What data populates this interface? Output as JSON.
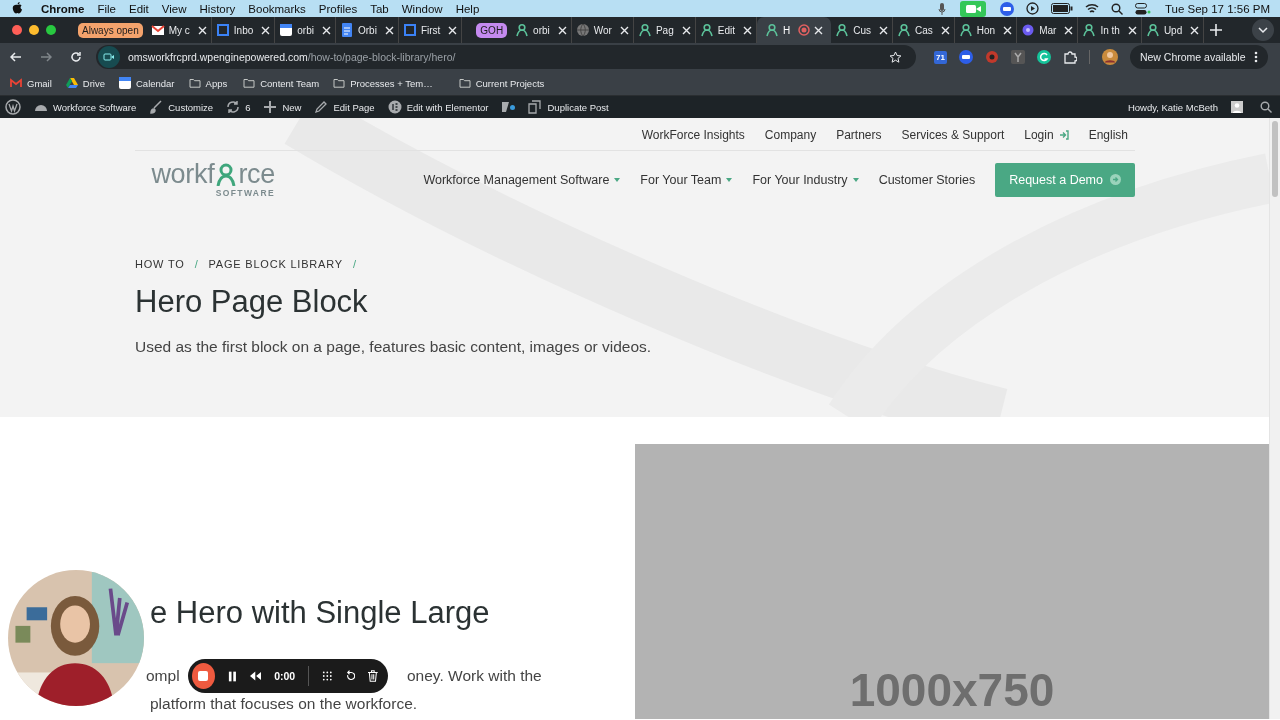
{
  "menu_bar": {
    "app": "Chrome",
    "items": [
      "File",
      "Edit",
      "View",
      "History",
      "Bookmarks",
      "Profiles",
      "Tab",
      "Window",
      "Help"
    ],
    "clock": "Tue Sep 17  1:56 PM"
  },
  "tabs": [
    {
      "label": "Always open",
      "kind": "group",
      "color": "#f4a36c"
    },
    {
      "label": "My c",
      "kind": "tab",
      "selected": false
    },
    {
      "label": "Inbo",
      "kind": "tab",
      "selected": false
    },
    {
      "label": "orbi",
      "kind": "tab",
      "selected": false
    },
    {
      "label": "Orbi",
      "kind": "tab",
      "selected": false
    },
    {
      "label": "First",
      "kind": "tab",
      "selected": false
    },
    {
      "label": "GOH",
      "kind": "group",
      "color": "#c58af0"
    },
    {
      "label": "orbi",
      "kind": "tab",
      "selected": false
    },
    {
      "label": "Wor",
      "kind": "tab",
      "selected": false
    },
    {
      "label": "Pag",
      "kind": "tab",
      "selected": false
    },
    {
      "label": "Edit",
      "kind": "tab",
      "selected": false
    },
    {
      "label": "H",
      "kind": "tab",
      "selected": true
    },
    {
      "label": "Cus",
      "kind": "tab",
      "selected": false
    },
    {
      "label": "Cas",
      "kind": "tab",
      "selected": false
    },
    {
      "label": "Hon",
      "kind": "tab",
      "selected": false
    },
    {
      "label": "Mar",
      "kind": "tab",
      "selected": false
    },
    {
      "label": "In th",
      "kind": "tab",
      "selected": false
    },
    {
      "label": "Upd",
      "kind": "tab",
      "selected": false
    }
  ],
  "address": {
    "host": "omsworkfrcprd.wpenginepowered.com",
    "path": "/how-to/page-block-library/hero/"
  },
  "extension_badge": "71",
  "update_button": "New Chrome available",
  "bookmarks": [
    {
      "label": "Gmail",
      "kind": "gmail"
    },
    {
      "label": "Drive",
      "kind": "drive"
    },
    {
      "label": "Calendar",
      "kind": "calendar"
    },
    {
      "label": "Apps",
      "kind": "folder"
    },
    {
      "label": "Content Team",
      "kind": "folder"
    },
    {
      "label": "Processes + Tem…",
      "kind": "folder"
    },
    {
      "label": "Current Projects",
      "kind": "folder"
    }
  ],
  "admin_bar": {
    "items": [
      {
        "label": "Workforce Software",
        "kind": "site"
      },
      {
        "label": "Customize",
        "kind": "brush"
      },
      {
        "label": "6",
        "kind": "updates"
      },
      {
        "label": "New",
        "kind": "plus"
      },
      {
        "label": "Edit Page",
        "kind": "pencil"
      },
      {
        "label": "Edit with Elementor",
        "kind": "elementor"
      },
      {
        "kind": "seo"
      },
      {
        "label": "Duplicate Post",
        "kind": "duplicate"
      }
    ],
    "greeting": "Howdy, Katie McBeth"
  },
  "site": {
    "utility_nav": [
      {
        "label": "WorkForce Insights",
        "kind": "link"
      },
      {
        "label": "Company",
        "kind": "link"
      },
      {
        "label": "Partners",
        "kind": "link"
      },
      {
        "label": "Services & Support",
        "kind": "link"
      },
      {
        "label": "Login",
        "kind": "login"
      },
      {
        "label": "English",
        "kind": "link"
      }
    ],
    "logo": {
      "start": "workf",
      "end": "rce",
      "tagline": "SOFTWARE"
    },
    "main_nav": [
      {
        "label": "Workforce Management Software",
        "dropdown": true
      },
      {
        "label": "For Your Team",
        "dropdown": true
      },
      {
        "label": "For Your Industry",
        "dropdown": true
      },
      {
        "label": "Customer Stories",
        "dropdown": false
      }
    ],
    "cta": "Request a Demo",
    "breadcrumb": {
      "items": [
        "HOW TO",
        "PAGE BLOCK LIBRARY"
      ],
      "separator": "/"
    },
    "title": "Hero Page Block",
    "subtitle": "Used as the first block on a page, features basic content, images or videos.",
    "section": {
      "heading": "e Hero with Single Large",
      "text_fragment": "ompl",
      "text_line_1": "oney. Work with the",
      "text_line_2": "platform that focuses on the workforce.",
      "image_label": "1000x750"
    }
  },
  "recorder": {
    "time": "0:00"
  }
}
